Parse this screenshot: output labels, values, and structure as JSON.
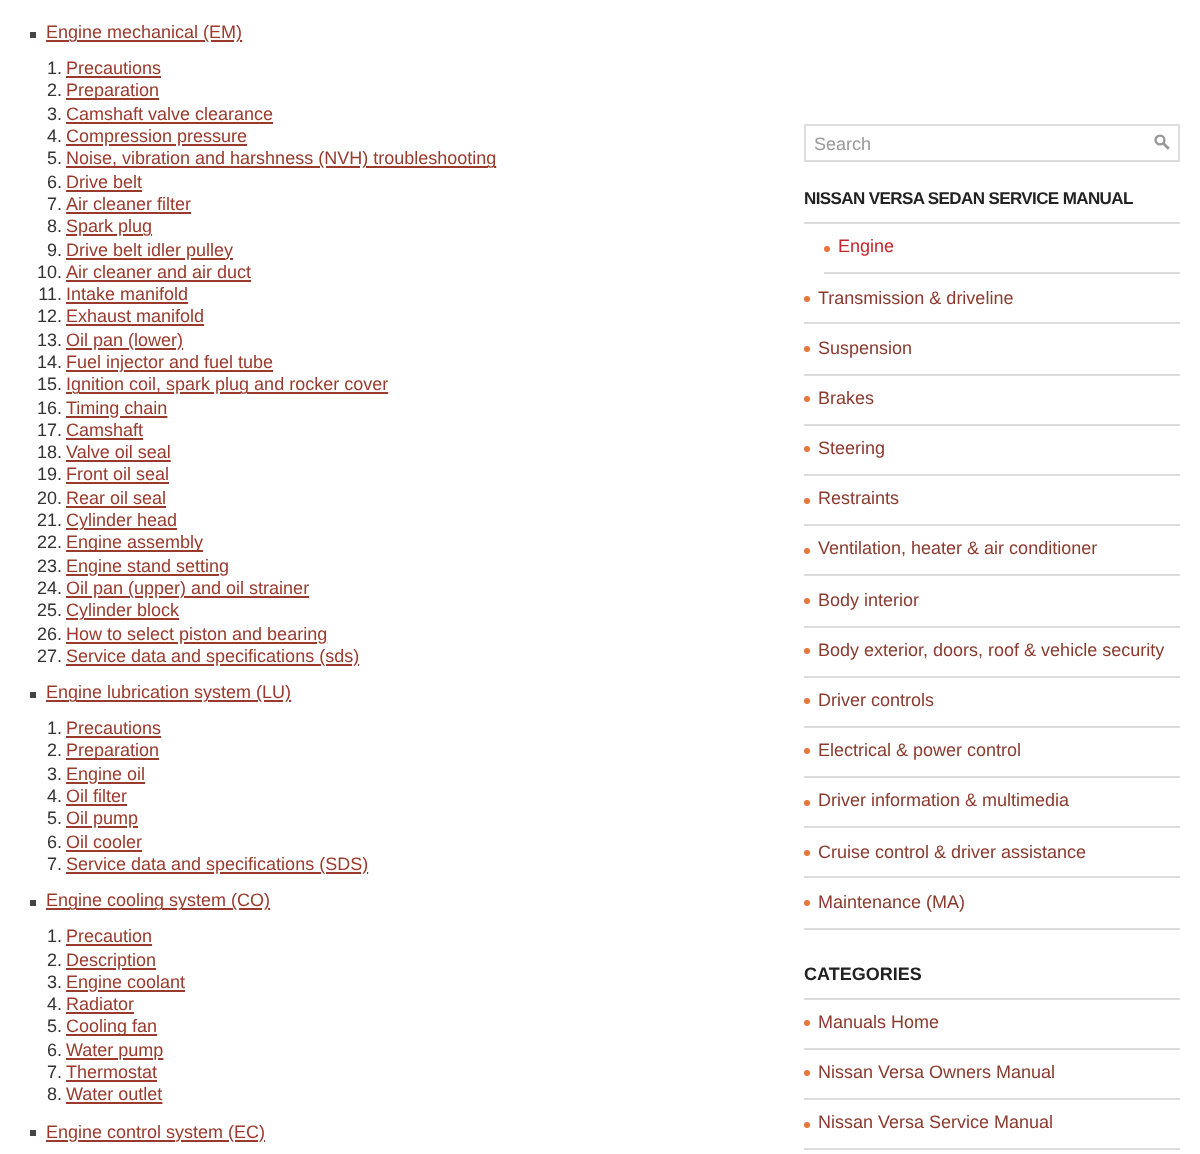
{
  "sections": [
    {
      "title": "Engine mechanical (EM)",
      "items": [
        {
          "number": "1.",
          "label": "Precautions"
        },
        {
          "number": "2.",
          "label": "Preparation"
        },
        {
          "number": "3.",
          "label": "Camshaft valve clearance"
        },
        {
          "number": "4.",
          "label": "Compression pressure"
        },
        {
          "number": "5.",
          "label": "Noise, vibration and harshness (NVH) troubleshooting"
        },
        {
          "number": "6.",
          "label": "Drive belt"
        },
        {
          "number": "7.",
          "label": "Air cleaner filter"
        },
        {
          "number": "8.",
          "label": "Spark plug"
        },
        {
          "number": "9.",
          "label": "Drive belt idler pulley"
        },
        {
          "number": "10.",
          "label": "Air cleaner and air duct"
        },
        {
          "number": "11.",
          "label": "Intake manifold"
        },
        {
          "number": "12.",
          "label": "Exhaust manifold"
        },
        {
          "number": "13.",
          "label": "Oil pan (lower)"
        },
        {
          "number": "14.",
          "label": "Fuel injector and fuel tube"
        },
        {
          "number": "15.",
          "label": "Ignition coil, spark plug and rocker cover"
        },
        {
          "number": "16.",
          "label": "Timing chain"
        },
        {
          "number": "17.",
          "label": "Camshaft"
        },
        {
          "number": "18.",
          "label": "Valve oil seal"
        },
        {
          "number": "19.",
          "label": "Front oil seal"
        },
        {
          "number": "20.",
          "label": "Rear oil seal"
        },
        {
          "number": "21.",
          "label": "Cylinder head"
        },
        {
          "number": "22.",
          "label": "Engine assembly"
        },
        {
          "number": "23.",
          "label": "Engine stand setting"
        },
        {
          "number": "24.",
          "label": "Oil pan (upper) and oil strainer"
        },
        {
          "number": "25.",
          "label": "Cylinder block"
        },
        {
          "number": "26.",
          "label": "How to select piston and bearing"
        },
        {
          "number": "27.",
          "label": "Service data and specifications (sds)"
        }
      ]
    },
    {
      "title": "Engine lubrication system (LU)",
      "items": [
        {
          "number": "1.",
          "label": "Precautions"
        },
        {
          "number": "2.",
          "label": "Preparation"
        },
        {
          "number": "3.",
          "label": "Engine oil"
        },
        {
          "number": "4.",
          "label": "Oil filter"
        },
        {
          "number": "5.",
          "label": "Oil pump"
        },
        {
          "number": "6.",
          "label": "Oil cooler"
        },
        {
          "number": "7.",
          "label": "Service data and specifications (SDS)"
        }
      ]
    },
    {
      "title": "Engine cooling system (CO)",
      "items": [
        {
          "number": "1.",
          "label": "Precaution"
        },
        {
          "number": "2.",
          "label": "Description"
        },
        {
          "number": "3.",
          "label": "Engine coolant"
        },
        {
          "number": "4.",
          "label": "Radiator"
        },
        {
          "number": "5.",
          "label": "Cooling fan"
        },
        {
          "number": "6.",
          "label": "Water pump"
        },
        {
          "number": "7.",
          "label": "Thermostat"
        },
        {
          "number": "8.",
          "label": "Water outlet"
        }
      ]
    },
    {
      "title": "Engine control system (EC)"
    }
  ],
  "sidebar": {
    "search": {
      "placeholder": "Search"
    },
    "manual": {
      "heading": "NISSAN VERSA SEDAN SERVICE MANUAL",
      "items": [
        {
          "label": "Engine",
          "selected": true
        },
        {
          "label": "Transmission & driveline",
          "selected": false
        },
        {
          "label": "Suspension",
          "selected": false
        },
        {
          "label": "Brakes",
          "selected": false
        },
        {
          "label": "Steering",
          "selected": false
        },
        {
          "label": "Restraints",
          "selected": false
        },
        {
          "label": "Ventilation, heater & air conditioner",
          "selected": false
        },
        {
          "label": "Body interior",
          "selected": false
        },
        {
          "label": "Body exterior, doors, roof & vehicle security",
          "selected": false
        },
        {
          "label": "Driver controls",
          "selected": false
        },
        {
          "label": "Electrical & power control",
          "selected": false
        },
        {
          "label": "Driver information & multimedia",
          "selected": false
        },
        {
          "label": "Cruise control & driver assistance",
          "selected": false
        },
        {
          "label": "Maintenance (MA)",
          "selected": false
        }
      ]
    },
    "categories": {
      "heading": "CATEGORIES",
      "items": [
        "Manuals Home",
        "Nissan Versa Owners Manual",
        "Nissan Versa Service Manual"
      ]
    }
  }
}
